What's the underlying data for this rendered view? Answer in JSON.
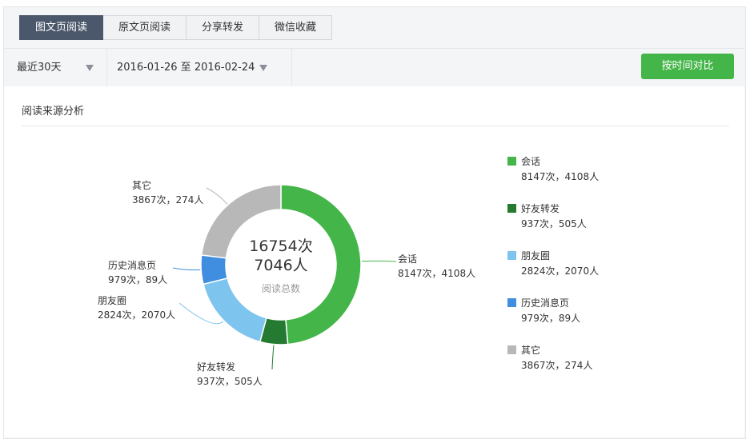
{
  "tabs": [
    {
      "label": "图文页阅读",
      "active": true
    },
    {
      "label": "原文页阅读",
      "active": false
    },
    {
      "label": "分享转发",
      "active": false
    },
    {
      "label": "微信收藏",
      "active": false
    }
  ],
  "filters": {
    "range_label": "最近30天",
    "date_range": "2016-01-26 至 2016-02-24",
    "compare_button": "按时间对比"
  },
  "section_title": "阅读来源分析",
  "center": {
    "times": "16754次",
    "people": "7046人",
    "caption": "阅读总数"
  },
  "chart_data": {
    "type": "pie",
    "donut": true,
    "title": "",
    "total_times": 16754,
    "total_people": 7046,
    "categories": [
      "会话",
      "好友转发",
      "朋友圈",
      "历史消息页",
      "其它"
    ],
    "values": [
      8147,
      937,
      2824,
      979,
      3867
    ],
    "people": [
      4108,
      505,
      2070,
      89,
      274
    ],
    "value_labels": [
      "8147次，4108人",
      "937次，505人",
      "2824次，2070人",
      "979次，89人",
      "3867次，274人"
    ],
    "colors": [
      "#44b549",
      "#237a30",
      "#7dc4ef",
      "#3f8ee0",
      "#b8b8b8"
    ],
    "legend_position": "right"
  }
}
